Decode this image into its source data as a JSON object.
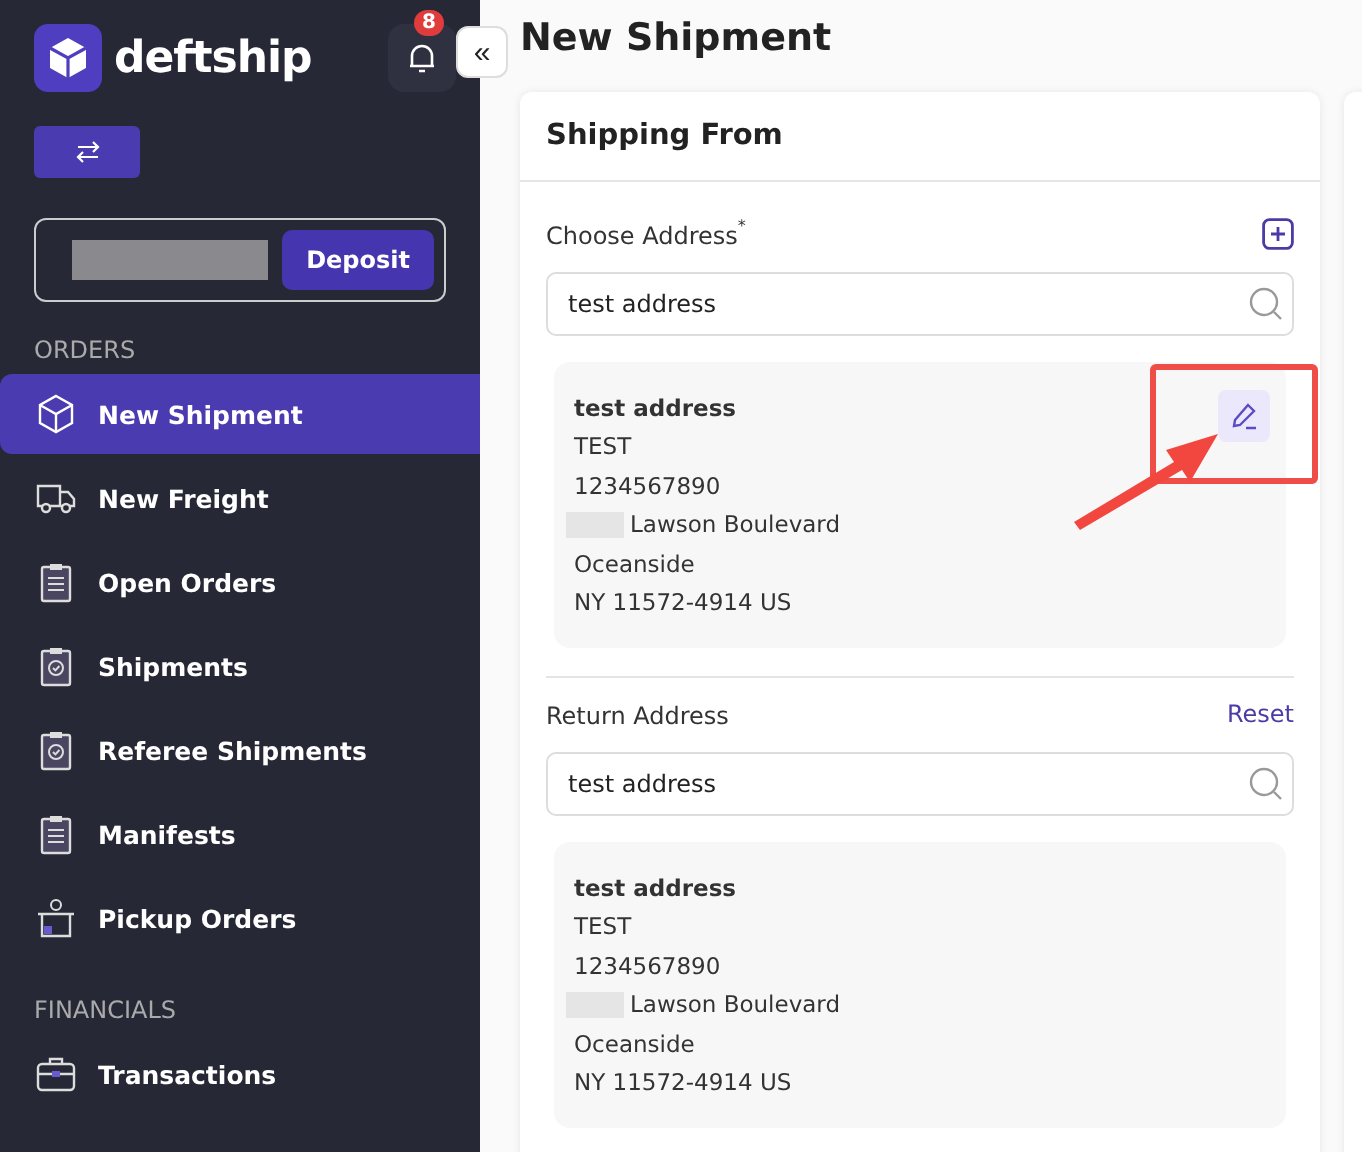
{
  "sidebar": {
    "brand": "deftship",
    "notifications": "8",
    "collapse": "«",
    "deposit": "Deposit",
    "sections": [
      {
        "title": "ORDERS",
        "items": [
          {
            "label": "New Shipment",
            "kind": "box",
            "selected": true
          },
          {
            "label": "New Freight",
            "kind": "truck",
            "selected": false
          },
          {
            "label": "Open Orders",
            "kind": "list",
            "selected": false
          },
          {
            "label": "Shipments",
            "kind": "check",
            "selected": false
          },
          {
            "label": "Referee Shipments",
            "kind": "check",
            "selected": false
          },
          {
            "label": "Manifests",
            "kind": "list",
            "selected": false
          },
          {
            "label": "Pickup Orders",
            "kind": "pickup",
            "selected": false
          }
        ]
      },
      {
        "title": "FINANCIALS",
        "items": [
          {
            "label": "Transactions",
            "kind": "briefcase",
            "selected": false
          }
        ]
      }
    ]
  },
  "page": {
    "title": "New Shipment"
  },
  "card": {
    "title": "Shipping From",
    "sections": [
      {
        "label": "Choose Address",
        "required_mark": "*",
        "kind": "add",
        "search": "test address",
        "address": [
          {
            "text": "test address",
            "redacted": false
          },
          {
            "text": "TEST",
            "redacted": false
          },
          {
            "text": "1234567890",
            "redacted": false
          },
          {
            "text": "Lawson Boulevard",
            "redacted": true
          },
          {
            "text": "Oceanside",
            "redacted": false
          },
          {
            "text": "NY 11572-4914 US",
            "redacted": false
          }
        ],
        "editable": true
      },
      {
        "label": "Return Address",
        "kind": "reset",
        "action_text": "Reset",
        "search": "test address",
        "address": [
          {
            "text": "test address",
            "redacted": false
          },
          {
            "text": "TEST",
            "redacted": false
          },
          {
            "text": "1234567890",
            "redacted": false
          },
          {
            "text": "Lawson Boulevard",
            "redacted": true
          },
          {
            "text": "Oceanside",
            "redacted": false
          },
          {
            "text": "NY 11572-4914 US",
            "redacted": false
          }
        ],
        "editable": false
      }
    ]
  }
}
